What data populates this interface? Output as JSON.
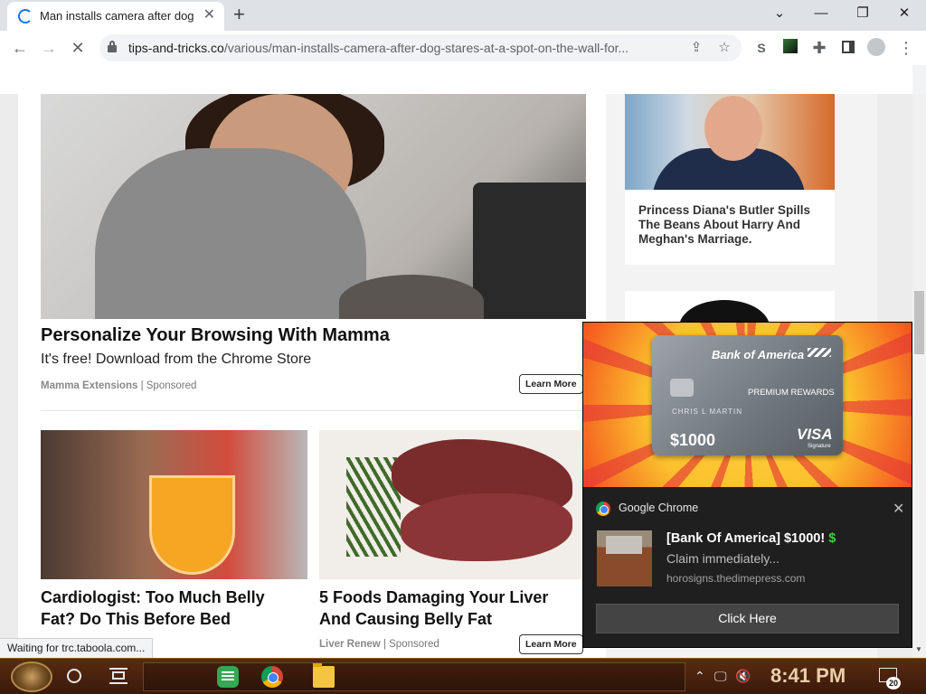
{
  "browser": {
    "tab_title": "Man installs camera after dog",
    "tab_close": "✕",
    "new_tab": "+",
    "window_controls": {
      "list": "⌄",
      "minimize": "—",
      "restore": "❐",
      "close": "✕"
    },
    "url_host": "tips-and-tricks.co",
    "url_path": "/various/man-installs-camera-after-dog-stares-at-a-spot-on-the-wall-for...",
    "status_text": "Waiting for trc.taboola.com..."
  },
  "main": {
    "hero": {
      "title": "Personalize Your Browsing With Mamma",
      "subtitle": "It's free! Download from the Chrome Store",
      "source": "Mamma Extensions",
      "sponsored": "Sponsored",
      "cta": "Learn More"
    },
    "cards": [
      {
        "title_line1": "Cardiologist: Too Much Belly",
        "title_line2": "Fat? Do This Before Bed"
      },
      {
        "title_line1": "5 Foods Damaging Your Liver",
        "title_line2": "And Causing Belly Fat",
        "source": "Liver Renew",
        "sponsored": "Sponsored",
        "cta": "Learn More"
      }
    ]
  },
  "sidebar": {
    "article": {
      "title": "Princess Diana's Butler Spills The Beans About Harry And Meghan's Marriage."
    }
  },
  "notification": {
    "card": {
      "bank": "Bank of America",
      "tier": "PREMIUM REWARDS",
      "holder": "CHRIS L MARTIN",
      "amount": "$1000",
      "network": "VISA",
      "network_sub": "Signature"
    },
    "app_name": "Google Chrome",
    "title": "[Bank Of America] $1000!",
    "title_symbol": "$",
    "body": "Claim immediately...",
    "source": "horosigns.thedimepress.com",
    "button": "Click Here",
    "close": "✕"
  },
  "taskbar": {
    "time": "8:41 PM",
    "notification_count": "20"
  }
}
